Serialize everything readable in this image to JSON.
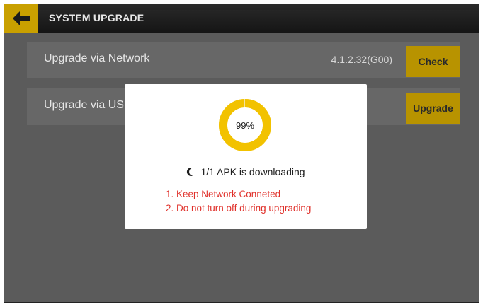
{
  "header": {
    "title": "SYSTEM UPGRADE",
    "back_icon": "arrow-left-icon"
  },
  "rows": [
    {
      "label": "Upgrade via Network",
      "value": "4.1.2.32(G00)",
      "button": "Check"
    },
    {
      "label": "Upgrade via US",
      "value": "",
      "button": "Upgrade"
    }
  ],
  "dialog": {
    "progress_percent": 99,
    "progress_text": "99%",
    "status_text": "1/1 APK is downloading",
    "notes": [
      "1. Keep Network Conneted",
      "2. Do not turn off during upgrading"
    ]
  },
  "colors": {
    "accent": "#f2c200",
    "button": "#b89300",
    "warning_text": "#e0302a",
    "overlay_bg": "#5b5b5b"
  }
}
